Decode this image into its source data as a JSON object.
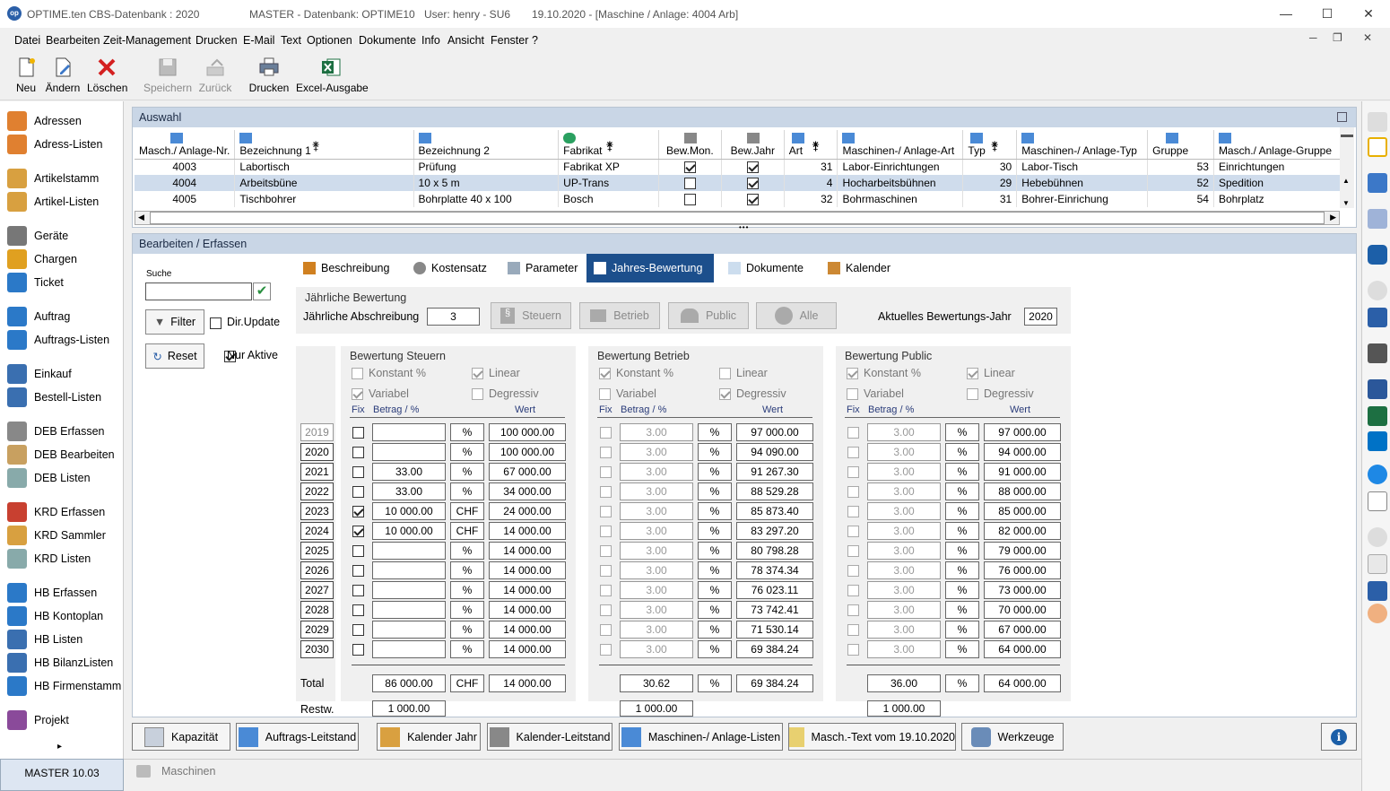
{
  "window": {
    "app": "OPTIME.ten",
    "db": "CBS-Datenbank : 2020",
    "master": "MASTER - Datenbank:  OPTIME10",
    "user": "User:  henry  -  SU6",
    "date_ctx": "19.10.2020 - [Maschine / Anlage: 4004  Arb]",
    "logo": "op"
  },
  "menu": [
    "Datei",
    "Bearbeiten",
    "Zeit-Management",
    "Drucken",
    "E-Mail",
    "Text",
    "Optionen",
    "Dokumente",
    "Info",
    "Ansicht",
    "Fenster",
    "?"
  ],
  "toolbar": {
    "new": "Neu",
    "edit": "Ändern",
    "delete": "Löschen",
    "save": "Speichern",
    "back": "Zurück",
    "print": "Drucken",
    "excel": "Excel-Ausgabe"
  },
  "sidebar": [
    "Adressen",
    "Adress-Listen",
    "Artikelstamm",
    "Artikel-Listen",
    "Geräte",
    "Chargen",
    "Ticket",
    "Auftrag",
    "Auftrags-Listen",
    "Einkauf",
    "Bestell-Listen",
    "DEB Erfassen",
    "DEB Bearbeiten",
    "DEB Listen",
    "KRD Erfassen",
    "KRD Sammler",
    "KRD Listen",
    "HB Erfassen",
    "HB Kontoplan",
    "HB Listen",
    "HB BilanzListen",
    "HB Firmenstamm",
    "Projekt"
  ],
  "sidebar_more": "▸",
  "status": "MASTER   10.03",
  "bottom_tab": "Maschinen",
  "auswahl": {
    "title": "Auswahl",
    "columns": [
      "Masch./ Anlage-Nr.",
      "Bezeichnung 1",
      "Bezeichnung 2",
      "Fabrikat",
      "Bew.Mon.",
      "Bew.Jahr",
      "Art",
      "Maschinen-/ Anlage-Art",
      "Typ",
      "Maschinen-/ Anlage-Typ",
      "Gruppe",
      "Masch./ Anlage-Gruppe"
    ],
    "rows": [
      {
        "nr": "4003",
        "bez1": "Labortisch",
        "bez2": "Prüfung",
        "fab": "Fabrikat XP",
        "mon": true,
        "jahr": true,
        "art": "31",
        "artn": "Labor-Einrichtungen",
        "typ": "30",
        "typn": "Labor-Tisch",
        "grp": "53",
        "grpn": "Einrichtungen"
      },
      {
        "nr": "4004",
        "bez1": "Arbeitsbüne",
        "bez2": "10 x 5 m",
        "fab": "UP-Trans",
        "mon": false,
        "jahr": true,
        "art": "4",
        "artn": "Hocharbeitsbühnen",
        "typ": "29",
        "typn": "Hebebühnen",
        "grp": "52",
        "grpn": "Spedition"
      },
      {
        "nr": "4005",
        "bez1": "Tischbohrer",
        "bez2": "Bohrplatte 40 x 100",
        "fab": "Bosch",
        "mon": false,
        "jahr": true,
        "art": "32",
        "artn": "Bohrmaschinen",
        "typ": "31",
        "typn": "Bohrer-Einrichung",
        "grp": "54",
        "grpn": "Bohrplatz"
      }
    ],
    "splitter": "•••"
  },
  "bearb": {
    "title": "Bearbeiten / Erfassen",
    "suche_label": "Suche",
    "suche_value": "",
    "filter": "Filter",
    "dirupdate": "Dir.Update",
    "reset": "Reset",
    "nuraktive": "Nur Aktive",
    "tabs": [
      "Beschreibung",
      "Kostensatz",
      "Parameter",
      "Jahres-Bewertung",
      "Dokumente",
      "Kalender"
    ],
    "jb_title": "Jährliche Bewertung",
    "abschreibung_label": "Jährliche Abschreibung",
    "abschreibung": "3",
    "steuern_btn": "Steuern",
    "betrieb_btn": "Betrieb",
    "public_btn": "Public",
    "alle_btn": "Alle",
    "akt_label": "Aktuelles Bewertungs-Jahr",
    "akt_jahr": "2020",
    "years": [
      "2019",
      "2020",
      "2021",
      "2022",
      "2023",
      "2024",
      "2025",
      "2026",
      "2027",
      "2028",
      "2029",
      "2030"
    ],
    "total_label": "Total",
    "restw_label": "Restw.",
    "hdr_fix": "Fix",
    "hdr_betrag": "Betrag / %",
    "hdr_wert": "Wert",
    "opt_konstant": "Konstant %",
    "opt_linear": "Linear",
    "opt_variabel": "Variabel",
    "opt_degressiv": "Degressiv",
    "steuern": {
      "title": "Bewertung Steuern",
      "fix": [
        false,
        false,
        false,
        false,
        true,
        true,
        false,
        false,
        false,
        false,
        false,
        false
      ],
      "betrag": [
        "",
        "",
        "33.00",
        "33.00",
        "10 000.00",
        "10 000.00",
        "",
        "",
        "",
        "",
        "",
        ""
      ],
      "unit": [
        "%",
        "%",
        "%",
        "%",
        "CHF",
        "CHF",
        "%",
        "%",
        "%",
        "%",
        "%",
        "%"
      ],
      "wert": [
        "100 000.00",
        "100 000.00",
        "67 000.00",
        "34 000.00",
        "24 000.00",
        "14 000.00",
        "14 000.00",
        "14 000.00",
        "14 000.00",
        "14 000.00",
        "14 000.00",
        "14 000.00"
      ],
      "total_betrag": "86 000.00",
      "total_unit": "CHF",
      "total_wert": "14 000.00",
      "restw": "1 000.00"
    },
    "betrieb": {
      "title": "Bewertung Betrieb",
      "betrag": [
        "3.00",
        "3.00",
        "3.00",
        "3.00",
        "3.00",
        "3.00",
        "3.00",
        "3.00",
        "3.00",
        "3.00",
        "3.00",
        "3.00"
      ],
      "unit": "%",
      "wert": [
        "97 000.00",
        "94 090.00",
        "91 267.30",
        "88 529.28",
        "85 873.40",
        "83 297.20",
        "80 798.28",
        "78 374.34",
        "76 023.11",
        "73 742.41",
        "71 530.14",
        "69 384.24"
      ],
      "total_betrag": "30.62",
      "total_unit": "%",
      "total_wert": "69 384.24",
      "restw": "1 000.00"
    },
    "public": {
      "title": "Bewertung Public",
      "betrag": [
        "3.00",
        "3.00",
        "3.00",
        "3.00",
        "3.00",
        "3.00",
        "3.00",
        "3.00",
        "3.00",
        "3.00",
        "3.00",
        "3.00"
      ],
      "unit": "%",
      "wert": [
        "97 000.00",
        "94 000.00",
        "91 000.00",
        "88 000.00",
        "85 000.00",
        "82 000.00",
        "79 000.00",
        "76 000.00",
        "73 000.00",
        "70 000.00",
        "67 000.00",
        "64 000.00"
      ],
      "total_betrag": "36.00",
      "total_unit": "%",
      "total_wert": "64 000.00",
      "restw": "1 000.00"
    }
  },
  "bottom_buttons": [
    "Kapazität",
    "Auftrags-Leitstand",
    "Kalender Jahr",
    "Kalender-Leitstand",
    "Maschinen-/ Anlage-Listen",
    "Masch.-Text vom 19.10.2020",
    "Werkzeuge"
  ],
  "info_icon": "i",
  "colors": {
    "accent": "#1c4f8c",
    "header": "#c9d6e6",
    "selected": "#cfdcec"
  }
}
